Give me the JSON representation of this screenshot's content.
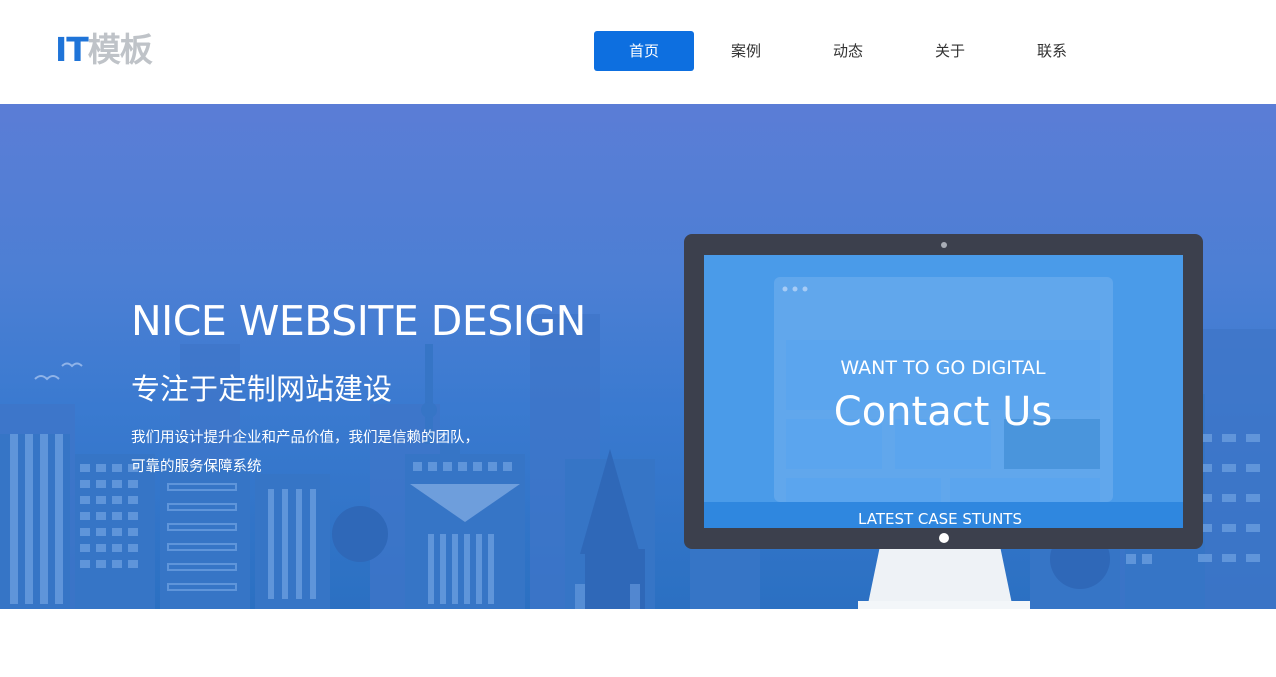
{
  "logo": {
    "part1": "IT",
    "part2": "模板"
  },
  "nav": {
    "items": [
      {
        "label": "首页",
        "active": true
      },
      {
        "label": "案例",
        "active": false
      },
      {
        "label": "动态",
        "active": false
      },
      {
        "label": "关于",
        "active": false
      },
      {
        "label": "联系",
        "active": false
      }
    ]
  },
  "hero": {
    "title": "NICE WEBSITE DESIGN",
    "subtitle": "专注于定制网站建设",
    "desc_line1": "我们用设计提升企业和产品价值，我们是信赖的团队，",
    "desc_line2": "可靠的服务保障系统"
  },
  "monitor": {
    "kicker": "WANT TO GO DIGITAL",
    "headline": "Contact Us",
    "footer_bar": "LATEST CASE STUNTS"
  },
  "colors": {
    "brand_blue": "#1f74d8",
    "nav_active": "#0d6fe0",
    "hero_top": "#5b7dd6",
    "hero_bottom": "#2b70c2",
    "monitor_frame": "#3c404d",
    "screen": "#4a9be9"
  }
}
